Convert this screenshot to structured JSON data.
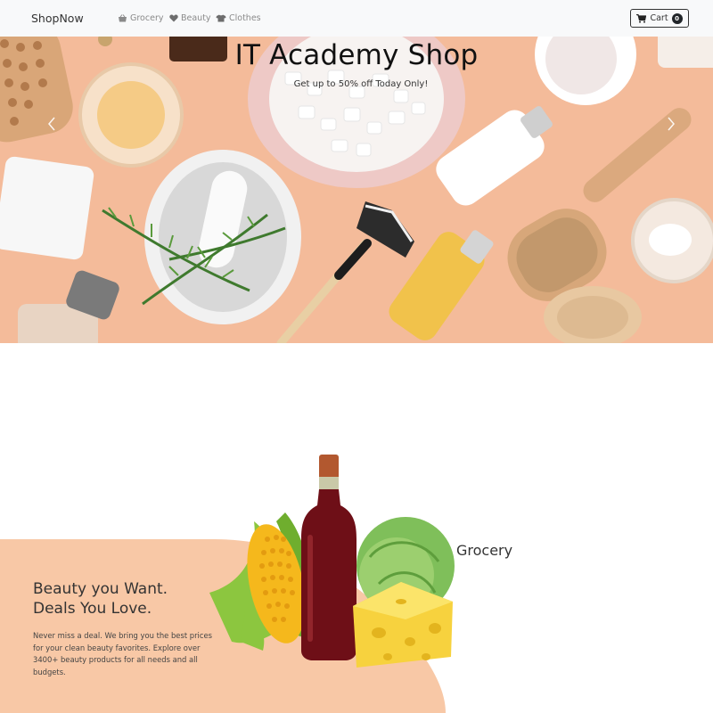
{
  "navbar": {
    "brand": "ShopNow",
    "links": [
      {
        "label": "Grocery",
        "icon": "basket-icon"
      },
      {
        "label": "Beauty",
        "icon": "heart-icon"
      },
      {
        "label": "Clothes",
        "icon": "tshirt-icon"
      }
    ],
    "cart": {
      "label": "Cart",
      "count": "0",
      "icon": "cart-icon"
    }
  },
  "hero": {
    "title": "IT Academy Shop",
    "subtitle": "Get up to 50% off Today Only!",
    "prev_icon": "chevron-left-icon",
    "next_icon": "chevron-right-icon",
    "background_color": "#f4bb9a"
  },
  "promo": {
    "title_line1": "Beauty you Want.",
    "title_line2": "Deals You Love.",
    "text": "Never miss a deal. We bring you the best prices for your clean beauty favorites. Explore over 3400+ beauty products for all needs and all budgets.",
    "background_color": "#f8c8a6"
  },
  "category": {
    "label": "Grocery"
  }
}
